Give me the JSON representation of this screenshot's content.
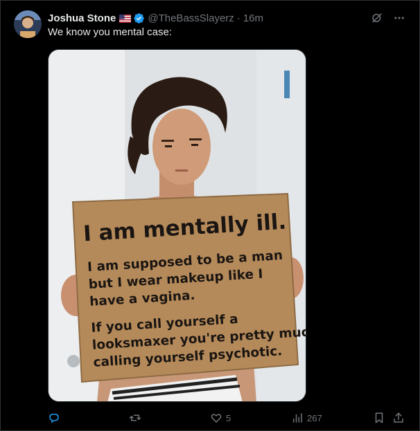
{
  "author": {
    "display_name": "Joshua Stone",
    "handle": "@TheBassSlayerz",
    "separator": "·",
    "time": "16m"
  },
  "tweet": {
    "text": "We know you mental case:"
  },
  "media": {
    "sign_lines": [
      "I am mentally ill.",
      "I am supposed to be a man",
      "but I wear makeup like I",
      "have a vagina.",
      "If you call yourself a",
      "looksmaxer you're pretty much",
      "calling yourself psychotic."
    ]
  },
  "actions": {
    "reply_count": "",
    "retweet_count": "",
    "like_count": "5",
    "view_count": "267"
  },
  "colors": {
    "background": "#000000",
    "text_primary": "#e7e9ea",
    "text_secondary": "#71767b",
    "verified_blue": "#1d9bf0",
    "border": "#2f3336",
    "cardboard": "#b58a5a"
  },
  "icons": {
    "verified": "verified-badge-icon",
    "flag": "us-flag-icon",
    "grok": "grok-icon",
    "more": "more-icon",
    "reply": "reply-icon",
    "retweet": "retweet-icon",
    "like": "heart-icon",
    "views": "views-icon",
    "bookmark": "bookmark-icon",
    "share": "share-icon"
  }
}
